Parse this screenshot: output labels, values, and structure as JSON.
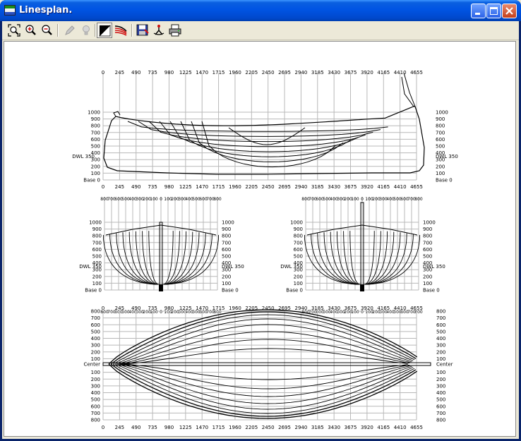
{
  "window": {
    "title": "Linesplan.",
    "controls": {
      "minimize": "minimize-icon",
      "maximize": "maximize-icon",
      "close": "close-icon"
    }
  },
  "toolbar": {
    "tools": [
      {
        "name": "zoom-extents",
        "icon": "zoom-extents-icon"
      },
      {
        "name": "zoom-in",
        "icon": "zoom-in-icon"
      },
      {
        "name": "zoom-out",
        "icon": "zoom-out-icon"
      },
      {
        "name": "pen",
        "icon": "pen-icon",
        "disabled": true
      },
      {
        "name": "light",
        "icon": "lightbulb-icon",
        "disabled": true
      },
      {
        "name": "black-white",
        "icon": "black-white-icon",
        "pressed": true
      },
      {
        "name": "colors",
        "icon": "color-curves-icon"
      },
      {
        "name": "save",
        "icon": "save-icon"
      },
      {
        "name": "properties",
        "icon": "properties-icon"
      },
      {
        "name": "print",
        "icon": "print-icon"
      }
    ]
  },
  "colors": {
    "grid": "#b8b8b8",
    "line": "#000000",
    "background": "#ffffff"
  },
  "linesplan": {
    "stations": [
      "0",
      "245",
      "490",
      "735",
      "980",
      "1225",
      "1470",
      "1715",
      "1960",
      "2205",
      "2450",
      "2695",
      "2940",
      "3185",
      "3430",
      "3675",
      "3920",
      "4165",
      "4410",
      "4655"
    ],
    "heights": [
      "1000",
      "900",
      "800",
      "700",
      "600",
      "500",
      "400",
      "300",
      "200",
      "100"
    ],
    "dwl_label": "DWL 350",
    "base_label": "Base 0",
    "center_label": "Center",
    "body_ticks": [
      "800",
      "700",
      "600",
      "500",
      "400",
      "300",
      "200",
      "100",
      "0",
      "100",
      "200",
      "300",
      "400",
      "500",
      "600",
      "700",
      "800"
    ],
    "half_breadths": [
      "800",
      "700",
      "600",
      "500",
      "400",
      "300",
      "200",
      "100"
    ]
  }
}
